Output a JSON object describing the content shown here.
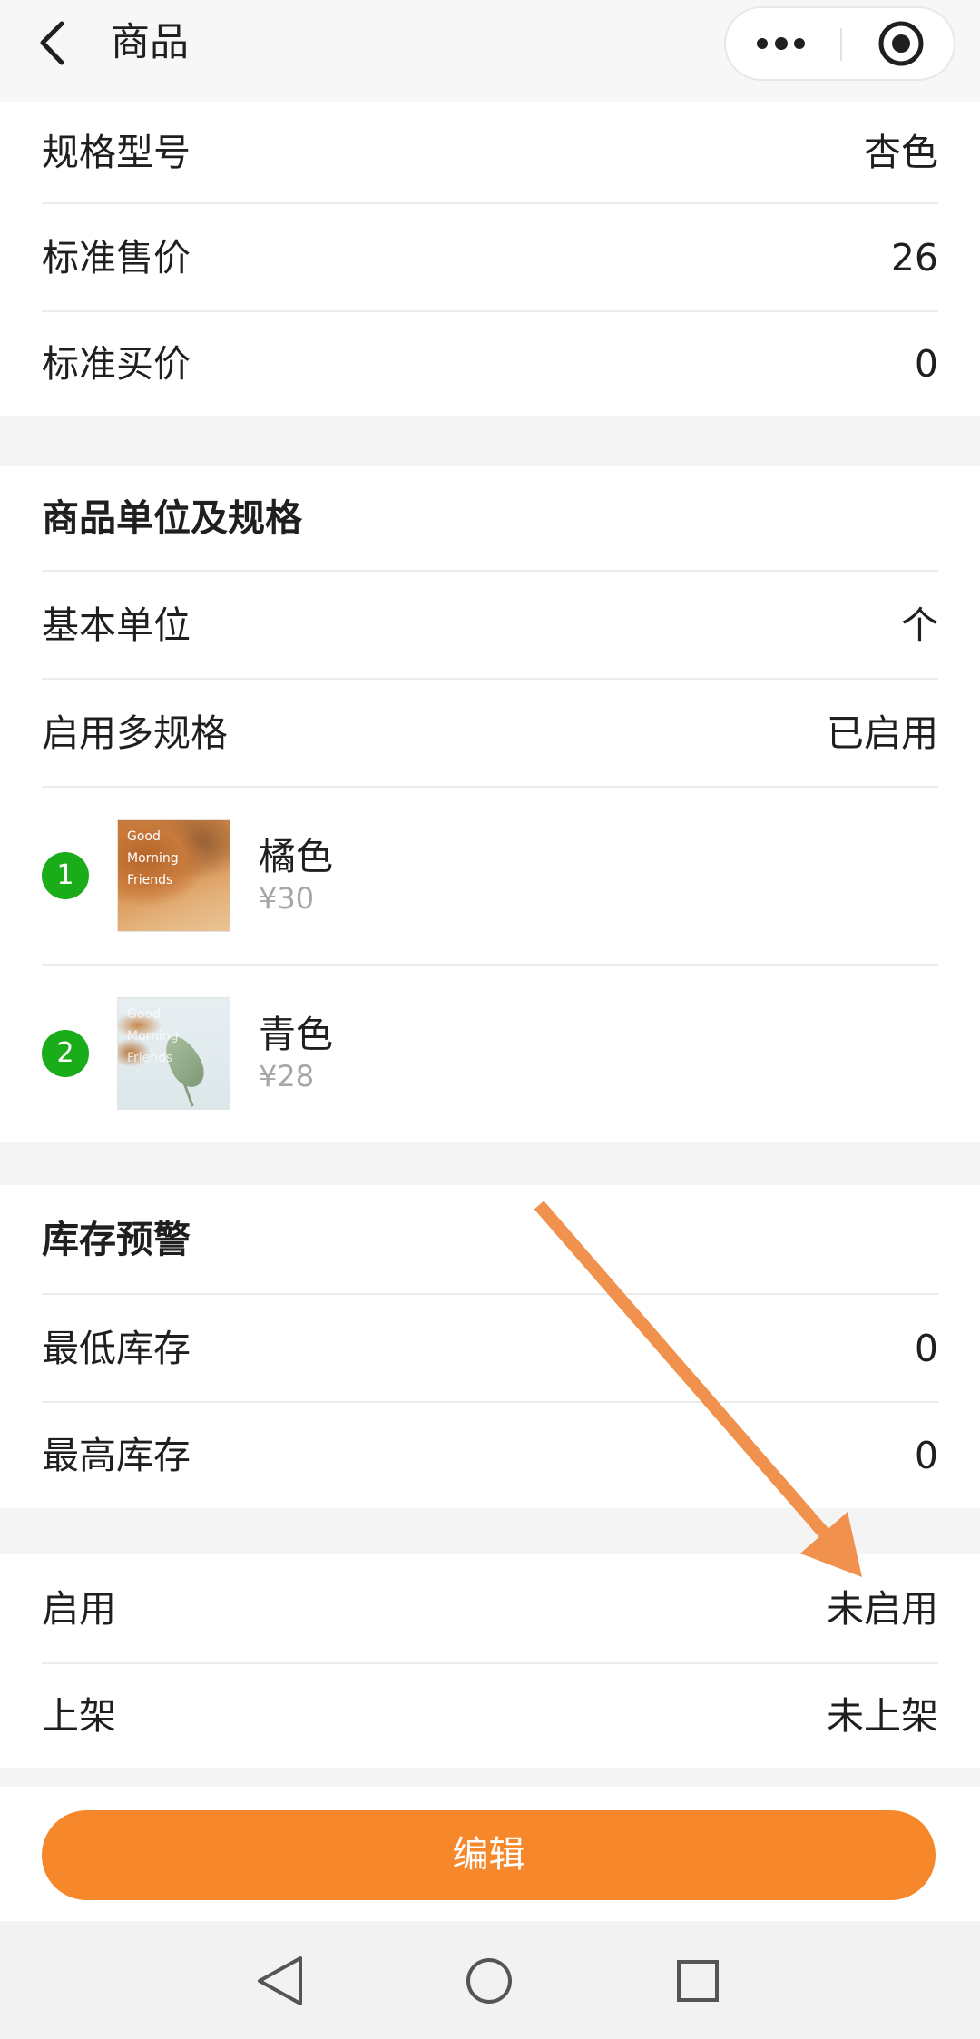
{
  "header": {
    "title": "商品",
    "back_icon": "chevron-left-icon",
    "more_icon": "more-dots-icon",
    "close_icon": "target-circle-icon"
  },
  "basic": {
    "rows": [
      {
        "label": "规格型号",
        "value": "杏色"
      },
      {
        "label": "标准售价",
        "value": "26"
      },
      {
        "label": "标准买价",
        "value": "0"
      }
    ]
  },
  "units": {
    "title": "商品单位及规格",
    "rows": [
      {
        "label": "基本单位",
        "value": "个"
      },
      {
        "label": "启用多规格",
        "value": "已启用"
      }
    ],
    "variants": [
      {
        "index": "1",
        "name": "橘色",
        "price": "¥30",
        "thumb_lines": [
          "Good",
          "Morning",
          "Friends"
        ]
      },
      {
        "index": "2",
        "name": "青色",
        "price": "¥28",
        "thumb_lines": [
          "Good",
          "Morning",
          "Friends"
        ]
      }
    ]
  },
  "stock_alert": {
    "title": "库存预警",
    "rows": [
      {
        "label": "最低库存",
        "value": "0"
      },
      {
        "label": "最高库存",
        "value": "0"
      }
    ]
  },
  "status": {
    "rows": [
      {
        "label": "启用",
        "value": "未启用"
      },
      {
        "label": "上架",
        "value": "未上架"
      }
    ]
  },
  "footer": {
    "edit_label": "编辑"
  },
  "navbar": {
    "back_icon": "nav-back-triangle-icon",
    "home_icon": "nav-home-circle-icon",
    "recent_icon": "nav-recents-square-icon"
  },
  "colors": {
    "accent": "#f7872b",
    "badge": "#1aad19",
    "annotation": "#f0924d"
  }
}
